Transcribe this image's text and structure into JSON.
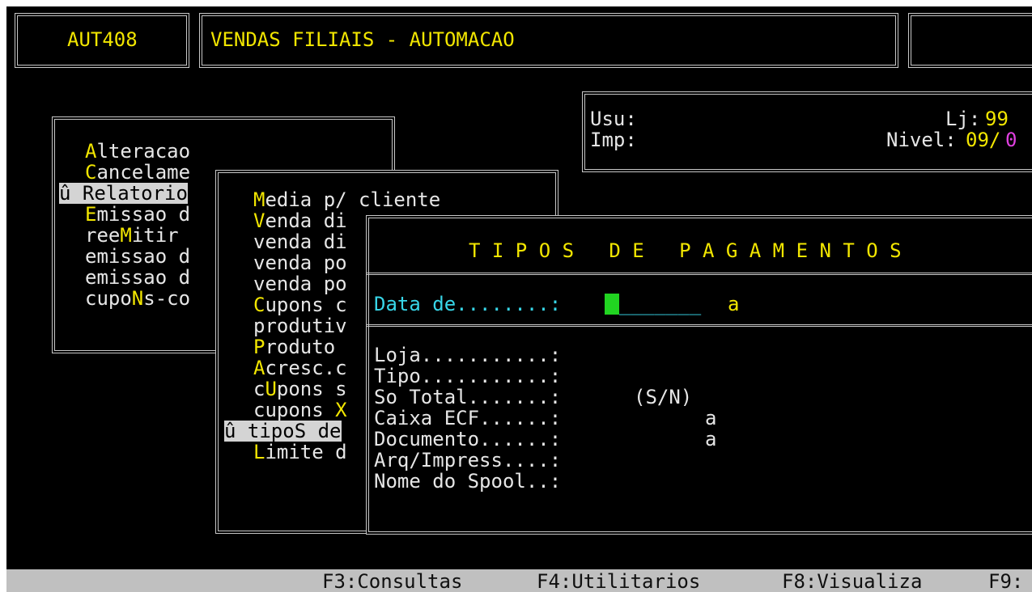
{
  "header": {
    "program_code": "AUT408",
    "title": "VENDAS FILIAIS - AUTOMACAO"
  },
  "user_panel": {
    "usu_label": "Usu:",
    "imp_label": "Imp:",
    "lj_label": "Lj:",
    "lj_value": "99",
    "nivel_label": "Nivel:",
    "nivel_value": "09/",
    "nivel_extra": "0"
  },
  "main_menu": {
    "items": [
      {
        "hot": "A",
        "rest": "lteracao",
        "marker": "",
        "selected": false
      },
      {
        "hot": "C",
        "rest": "ancelame",
        "marker": "",
        "selected": false
      },
      {
        "hot": "R",
        "rest": "elatorio",
        "marker": "û ",
        "selected": true
      },
      {
        "hot": "E",
        "rest": "missao d",
        "marker": "",
        "selected": false
      },
      {
        "pre": "ree",
        "hot": "M",
        "rest": "itir",
        "marker": "",
        "selected": false
      },
      {
        "pre": "emissao d",
        "hot": "",
        "rest": "",
        "marker": "",
        "selected": false
      },
      {
        "pre": "emissao d",
        "hot": "",
        "rest": "",
        "marker": "",
        "selected": false
      },
      {
        "pre": "cupo",
        "hot": "N",
        "rest": "s-co",
        "marker": "",
        "selected": false
      }
    ]
  },
  "report_menu": {
    "items": [
      {
        "pre": "",
        "hot": "M",
        "rest": "edia p/ cliente",
        "marker": ""
      },
      {
        "pre": "",
        "hot": "V",
        "rest": "enda di",
        "marker": ""
      },
      {
        "pre": "venda di",
        "hot": "",
        "rest": "",
        "marker": ""
      },
      {
        "pre": "venda po",
        "hot": "",
        "rest": "",
        "marker": ""
      },
      {
        "pre": "venda po",
        "hot": "",
        "rest": "",
        "marker": ""
      },
      {
        "pre": "",
        "hot": "C",
        "rest": "upons c",
        "marker": ""
      },
      {
        "pre": "produtiv",
        "hot": "",
        "rest": "",
        "marker": ""
      },
      {
        "pre": "",
        "hot": "P",
        "rest": "roduto ",
        "marker": ""
      },
      {
        "pre": "",
        "hot": "A",
        "rest": "cresc.c",
        "marker": ""
      },
      {
        "pre": "c",
        "hot": "U",
        "rest": "pons s",
        "marker": ""
      },
      {
        "pre": "cupons ",
        "hot": "X",
        "rest": "",
        "marker": ""
      },
      {
        "pre": "tipo",
        "hot": "S",
        "rest": " de",
        "marker": "û "
      },
      {
        "pre": "",
        "hot": "L",
        "rest": "imite d",
        "marker": ""
      }
    ]
  },
  "dialog": {
    "title": "T I P O S   D E   P A G A M E N T O S",
    "date_label": "Data de........:",
    "date_placeholder": "_______",
    "date_sep": "a",
    "fields": [
      {
        "label": "Loja...........:",
        "value": ""
      },
      {
        "label": "Tipo...........:",
        "value": ""
      },
      {
        "label": "So Total.......:",
        "value": "(S/N)"
      },
      {
        "label": "Caixa ECF......:",
        "value": "a"
      },
      {
        "label": "Documento......:",
        "value": "a"
      },
      {
        "label": "Arq/Impress....:",
        "value": ""
      },
      {
        "label": "Nome do Spool..:",
        "value": ""
      }
    ]
  },
  "statusbar": {
    "f3": "F3:Consultas",
    "f4": "F4:Utilitarios",
    "f8": "F8:Visualiza",
    "f9": "F9:"
  },
  "colors": {
    "background": "#000000",
    "hotkey": "#f2e600",
    "input_label": "#38d6e8",
    "cursor": "#21d421",
    "statusbar": "#c0c0c0",
    "highlight": "#d4d4d4"
  }
}
